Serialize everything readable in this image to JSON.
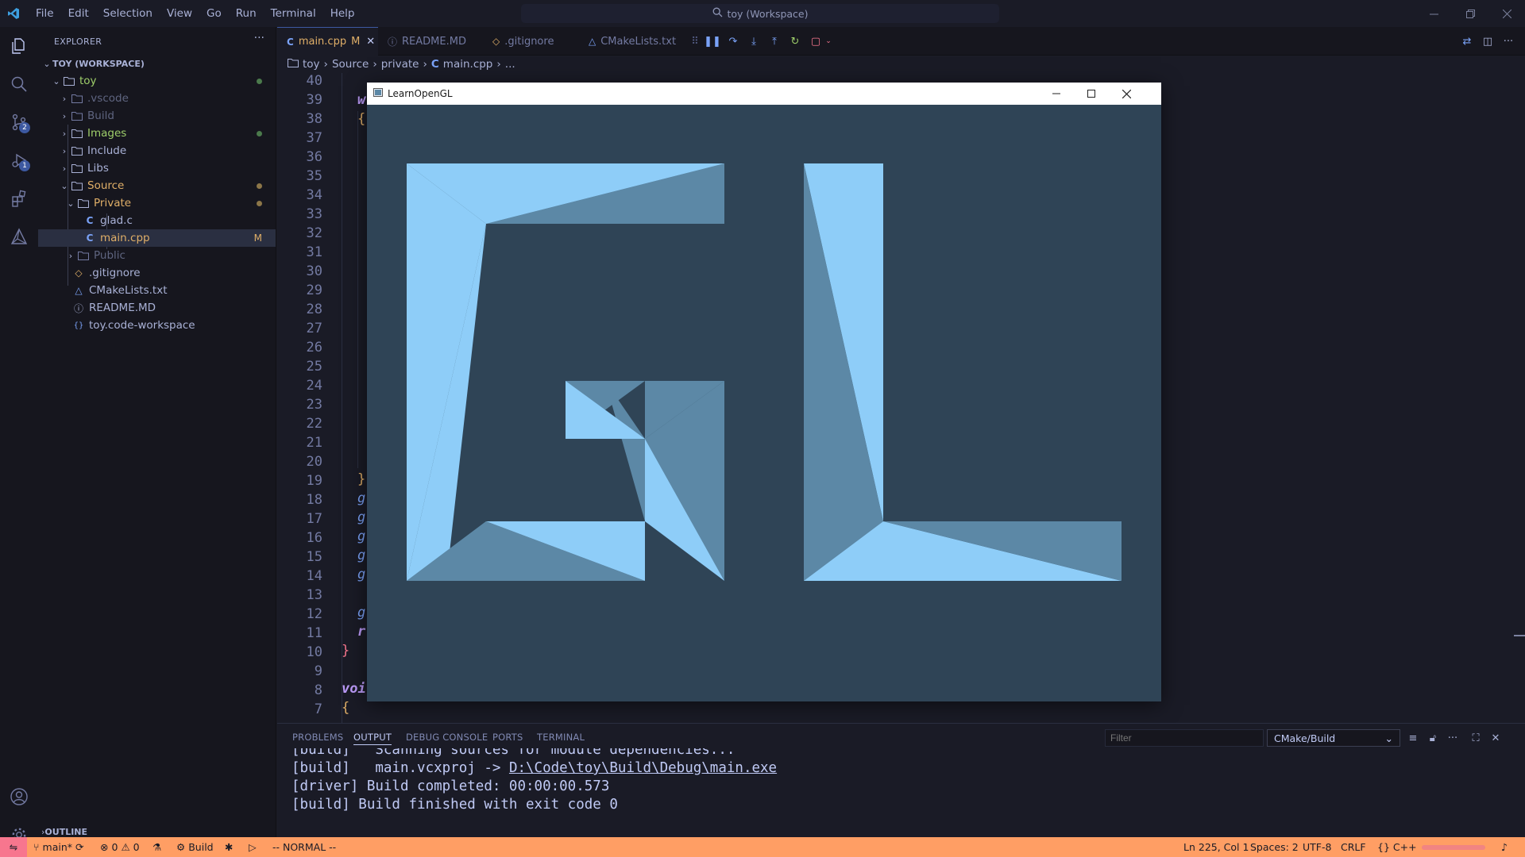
{
  "titlebar": {
    "menu": [
      "File",
      "Edit",
      "Selection",
      "View",
      "Go",
      "Run",
      "Terminal",
      "Help"
    ],
    "search_text": "toy (Workspace)"
  },
  "activity": {
    "scm_badge": "2",
    "debug_badge": "1"
  },
  "sidebar": {
    "title": "EXPLORER",
    "workspace_label": "TOY (WORKSPACE)",
    "items": [
      {
        "label": "toy"
      },
      {
        "label": ".vscode"
      },
      {
        "label": "Build"
      },
      {
        "label": "Images"
      },
      {
        "label": "Include"
      },
      {
        "label": "Libs"
      },
      {
        "label": "Source"
      },
      {
        "label": "Private"
      },
      {
        "label": "glad.c"
      },
      {
        "label": "main.cpp",
        "badge": "M"
      },
      {
        "label": "Public"
      },
      {
        "label": ".gitignore"
      },
      {
        "label": "CMakeLists.txt"
      },
      {
        "label": "README.MD"
      },
      {
        "label": "toy.code-workspace"
      }
    ],
    "outline_label": "OUTLINE"
  },
  "tabs": [
    {
      "label": "main.cpp",
      "badge": "M"
    },
    {
      "label": "README.MD"
    },
    {
      "label": ".gitignore"
    },
    {
      "label": "CMakeLists.txt"
    }
  ],
  "breadcrumb": [
    "toy",
    "Source",
    "private",
    "main.cpp",
    "..."
  ],
  "editor": {
    "line_numbers": [
      "40",
      "39",
      "38",
      "37",
      "36",
      "35",
      "34",
      "33",
      "32",
      "31",
      "30",
      "29",
      "28",
      "27",
      "26",
      "25",
      "24",
      "23",
      "22",
      "21",
      "20",
      "19",
      "18",
      "17",
      "16",
      "15",
      "14",
      "13",
      "12",
      "11",
      "10",
      "9",
      "8",
      "7"
    ],
    "code_fragments": {
      "l39": "w",
      "l38": "{",
      "l19": "}",
      "l18": "g",
      "l17": "g",
      "l16": "g",
      "l15": "g",
      "l14": "g",
      "l12": "g",
      "l11": "r",
      "l10": "}",
      "l8": "voi",
      "l7": "{"
    }
  },
  "glwindow": {
    "title": "LearnOpenGL",
    "background": "#2f4456",
    "light_color": "#8ecdf8",
    "dark_color": "#5c88a6"
  },
  "panel": {
    "tabs": [
      "PROBLEMS",
      "OUTPUT",
      "DEBUG CONSOLE",
      "PORTS",
      "TERMINAL"
    ],
    "filter_placeholder": "Filter",
    "channel": "CMake/Build",
    "output": {
      "line0": "[build]   Scanning sources for module dependencies...",
      "line1_prefix": "[build]   main.vcxproj -> ",
      "line1_link": "D:\\Code\\toy\\Build\\Debug\\main.exe",
      "line2": "[driver] Build completed: 00:00:00.573",
      "line3": "[build] Build finished with exit code 0"
    }
  },
  "statusbar": {
    "branch": "main*",
    "errors": "0",
    "warnings": "0",
    "build": "Build",
    "mode": "-- NORMAL --",
    "position": "Ln 225, Col 1",
    "spaces": "Spaces: 2",
    "encoding": "UTF-8",
    "eol": "CRLF",
    "language": "C++"
  },
  "colors": {
    "accent": "#3d59a1",
    "statusbar": "#ff9e64",
    "modified": "#e0af68",
    "git_added": "#9ece6a"
  }
}
